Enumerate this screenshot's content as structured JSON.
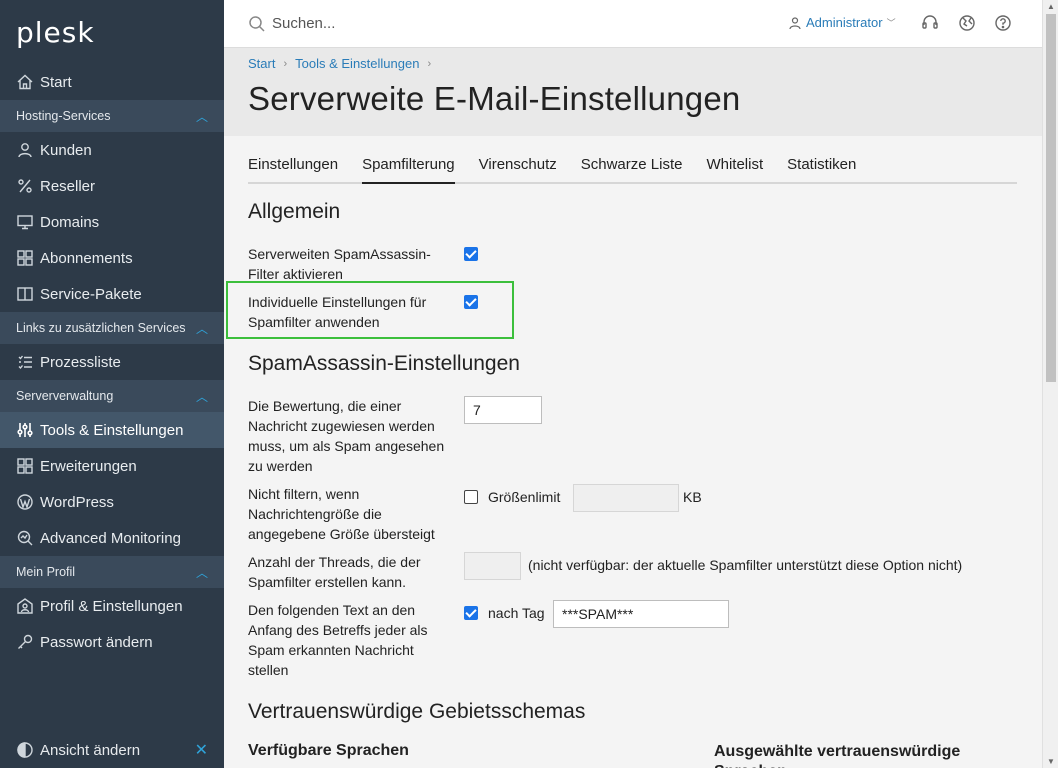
{
  "brand": {
    "logo_text": "plesk"
  },
  "sidebar": {
    "start": "Start",
    "sections": [
      {
        "label": "Hosting-Services",
        "items": [
          "Kunden",
          "Reseller",
          "Domains",
          "Abonnements",
          "Service-Pakete"
        ]
      },
      {
        "label": "Links zu zusätzlichen Services",
        "items": [
          "Prozessliste"
        ]
      },
      {
        "label": "Serververwaltung",
        "items": [
          "Tools & Einstellungen",
          "Erweiterungen",
          "WordPress",
          "Advanced Monitoring"
        ]
      },
      {
        "label": "Mein Profil",
        "items": [
          "Profil & Einstellungen",
          "Passwort ändern"
        ]
      }
    ],
    "footer_label": "Ansicht ändern",
    "active_item": "Tools & Einstellungen"
  },
  "topbar": {
    "search_placeholder": "Suchen...",
    "user_label": "Administrator"
  },
  "breadcrumb": {
    "items": [
      "Start",
      "Tools & Einstellungen"
    ]
  },
  "page": {
    "title": "Serverweite E-Mail-Einstellungen"
  },
  "tabs": {
    "items": [
      "Einstellungen",
      "Spamfilterung",
      "Virenschutz",
      "Schwarze Liste",
      "Whitelist",
      "Statistiken"
    ],
    "active": "Spamfilterung"
  },
  "general": {
    "title": "Allgemein",
    "enable_spamassassin_label": "Serverweiten SpamAssassin-Filter aktivieren",
    "enable_spamassassin_checked": true,
    "individual_settings_label": "Individuelle Einstellungen für Spamfilter anwenden",
    "individual_settings_checked": true
  },
  "spamassassin": {
    "title": "SpamAssassin-Einstellungen",
    "score_label": "Die Bewertung, die einer Nachricht zugewiesen werden muss, um als Spam angesehen zu werden",
    "score_value": "7",
    "size_filter_label": "Nicht filtern, wenn Nachrichtengröße die angegebene Größe übersteigt",
    "size_limit_checked": false,
    "size_limit_label": "Größenlimit",
    "size_limit_value": "",
    "size_unit": "KB",
    "threads_label": "Anzahl der Threads, die der Spamfilter erstellen kann.",
    "threads_value": "",
    "threads_note": "(nicht verfügbar: der aktuelle Spamfilter unterstützt diese Option nicht)",
    "subject_tag_label": "Den folgenden Text an den Anfang des Betreffs jeder als Spam erkannten Nachricht stellen",
    "subject_tag_checked": true,
    "subject_tag_option": "nach Tag",
    "subject_tag_value": "***SPAM***"
  },
  "trusted_locales": {
    "title": "Vertrauenswürdige Gebietsschemas",
    "available_title": "Verfügbare Sprachen",
    "selected_title": "Ausgewählte vertrauenswürdige Sprachen"
  }
}
